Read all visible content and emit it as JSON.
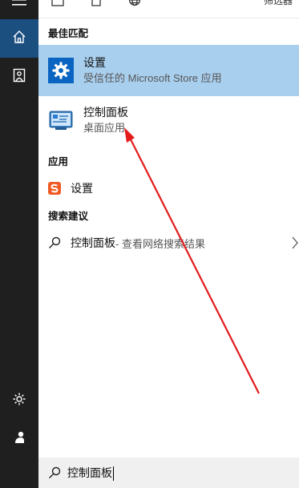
{
  "top": {
    "filter_label": "筛选器"
  },
  "sections": {
    "best_match": "最佳匹配",
    "apps": "应用",
    "search_suggestions": "搜索建议"
  },
  "results": {
    "settings_best": {
      "title": "设置",
      "subtitle": "受信任的 Microsoft Store 应用"
    },
    "control_panel": {
      "title": "控制面板",
      "subtitle": "桌面应用"
    },
    "settings_app": {
      "title": "设置"
    },
    "web_suggestion": {
      "query": "控制面板",
      "suffix": " - 查看网络搜索结果"
    }
  },
  "search": {
    "value": "控制面板"
  },
  "colors": {
    "sidebar_bg": "#1f1f1f",
    "sidebar_active": "#1b4f80",
    "selected_bg": "#a9cfee",
    "settings_icon_bg": "#0a64c1",
    "annotation_arrow": "#e31b1b",
    "sogou_icon": "#f05a24"
  },
  "icons": {
    "menu": "hamburger-icon",
    "home": "home-icon",
    "documents": "document-icon",
    "settings": "gear-icon",
    "user": "person-icon",
    "search": "search-icon",
    "chevron": "chevron-right-icon"
  }
}
